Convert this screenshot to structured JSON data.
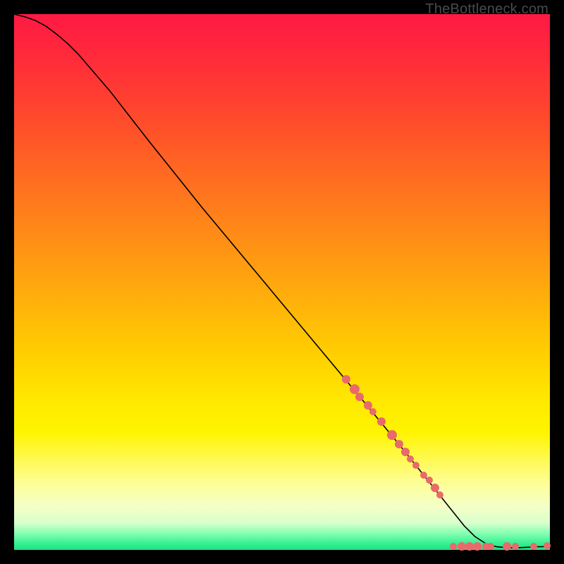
{
  "watermark": "TheBottleneck.com",
  "chart_data": {
    "type": "line",
    "title": "",
    "xlabel": "",
    "ylabel": "",
    "xlim": [
      0,
      100
    ],
    "ylim": [
      0,
      100
    ],
    "grid": false,
    "series": [
      {
        "name": "curve",
        "kind": "line",
        "x": [
          0,
          2,
          4,
          6,
          8,
          10,
          12,
          18,
          25,
          35,
          45,
          55,
          65,
          72,
          76,
          80,
          82,
          84,
          86,
          88,
          90,
          92,
          94,
          96,
          98,
          100
        ],
        "y": [
          100,
          99.5,
          98.8,
          97.7,
          96.2,
          94.5,
          92.5,
          85.5,
          76.5,
          64.0,
          52.0,
          40.0,
          28.0,
          19.5,
          14.5,
          9.5,
          7.0,
          4.5,
          2.5,
          1.2,
          0.6,
          0.4,
          0.4,
          0.5,
          0.6,
          0.6
        ]
      },
      {
        "name": "points",
        "kind": "scatter",
        "points": [
          {
            "x": 62.0,
            "y": 31.8,
            "r": 6
          },
          {
            "x": 63.5,
            "y": 30.0,
            "r": 7
          },
          {
            "x": 64.5,
            "y": 28.6,
            "r": 6
          },
          {
            "x": 66.0,
            "y": 27.0,
            "r": 6
          },
          {
            "x": 67.0,
            "y": 25.8,
            "r": 5
          },
          {
            "x": 68.5,
            "y": 24.0,
            "r": 6
          },
          {
            "x": 70.5,
            "y": 21.4,
            "r": 7
          },
          {
            "x": 71.8,
            "y": 19.8,
            "r": 6
          },
          {
            "x": 73.0,
            "y": 18.3,
            "r": 6
          },
          {
            "x": 74.0,
            "y": 17.0,
            "r": 5
          },
          {
            "x": 75.0,
            "y": 15.8,
            "r": 5
          },
          {
            "x": 76.5,
            "y": 14.0,
            "r": 5
          },
          {
            "x": 77.5,
            "y": 13.0,
            "r": 5
          },
          {
            "x": 78.5,
            "y": 11.6,
            "r": 6
          },
          {
            "x": 79.5,
            "y": 10.2,
            "r": 5
          },
          {
            "x": 82.0,
            "y": 0.6,
            "r": 5
          },
          {
            "x": 83.5,
            "y": 0.6,
            "r": 6
          },
          {
            "x": 85.0,
            "y": 0.6,
            "r": 6
          },
          {
            "x": 86.5,
            "y": 0.6,
            "r": 6
          },
          {
            "x": 88.0,
            "y": 0.6,
            "r": 5
          },
          {
            "x": 89.0,
            "y": 0.6,
            "r": 5
          },
          {
            "x": 92.0,
            "y": 0.6,
            "r": 6
          },
          {
            "x": 93.5,
            "y": 0.6,
            "r": 5
          },
          {
            "x": 97.0,
            "y": 0.6,
            "r": 5
          },
          {
            "x": 99.5,
            "y": 0.8,
            "r": 5
          }
        ]
      }
    ]
  }
}
